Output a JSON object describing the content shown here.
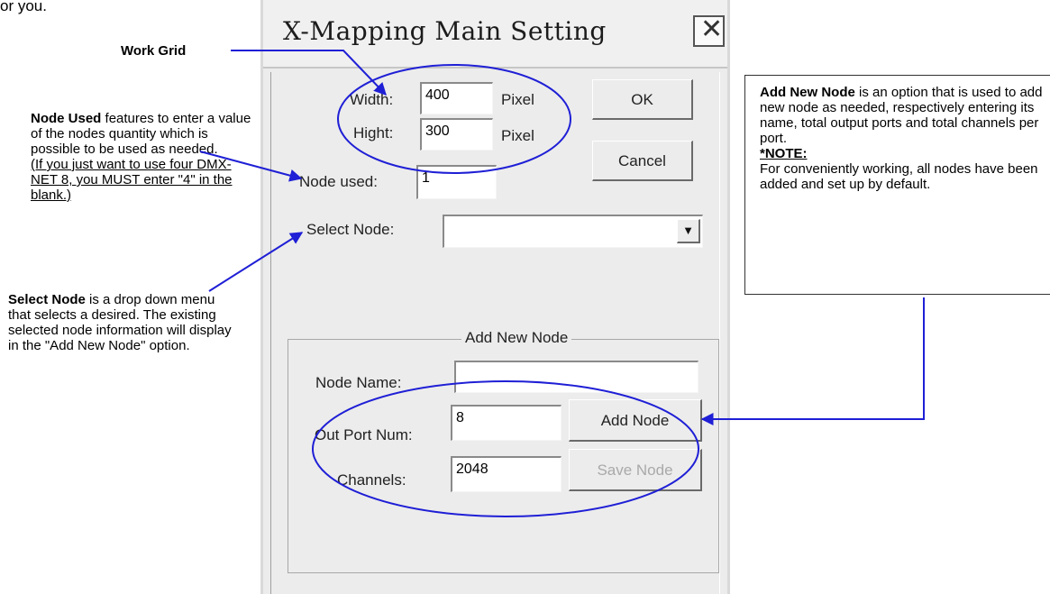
{
  "top_fragment": "or you.",
  "dialog": {
    "title": "X-Mapping Main Setting",
    "close_glyph": "✕",
    "width_label": "Width:",
    "width_value": "400",
    "width_unit": "Pixel",
    "height_label": "Hight:",
    "height_value": "300",
    "height_unit": "Pixel",
    "ok_label": "OK",
    "cancel_label": "Cancel",
    "node_used_label": "Node used:",
    "node_used_value": "1",
    "select_node_label": "Select Node:",
    "select_node_value": "",
    "dropdown_arrow": "▼",
    "group_title": "Add New Node",
    "node_name_label": "Node Name:",
    "node_name_value": "",
    "out_port_label": "Out Port Num:",
    "out_port_value": "8",
    "channels_label": "Channels:",
    "channels_value": "2048",
    "add_node_label": "Add Node",
    "save_node_label": "Save Node"
  },
  "annotations": {
    "work_grid": "Work Grid",
    "node_used_title": "Node Used",
    "node_used_text": " features to enter a value of the nodes quantity which is possible to be used as needed.",
    "node_used_note": "(If you just want to use four DMX-NET 8, you MUST enter \"4\" in the blank.)",
    "select_node_title": "Select Node",
    "select_node_text": " is a drop down menu that selects a desired. The existing selected node information will display in the \"Add New Node\" option.",
    "add_node_title": "Add New Node",
    "add_node_text": " is an option that is used to add new node as needed, respectively entering its name, total output ports and total channels per port.",
    "note_label": "*NOTE:",
    "note_text": "For conveniently working, all nodes have been added and set up by default."
  },
  "colors": {
    "annotation_blue": "#1f1fd6"
  }
}
